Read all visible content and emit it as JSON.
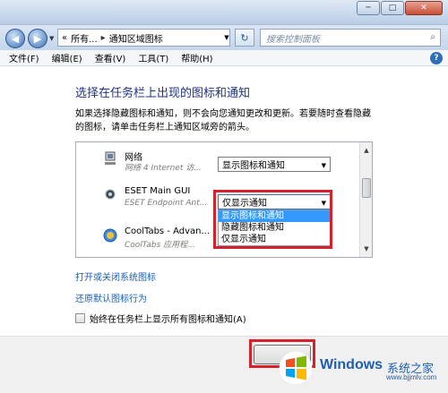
{
  "window": {
    "min_symbol": "─",
    "max_symbol": "□",
    "close_symbol": "✕"
  },
  "nav": {
    "back_symbol": "◀",
    "forward_symbol": "▶",
    "dropdown_symbol": "▼",
    "breadcrumb": [
      "«",
      "所有...",
      "▸",
      "通知区域图标"
    ],
    "refresh_symbol": "↻",
    "search_placeholder": "搜索控制面板",
    "search_icon": "⌕"
  },
  "menu": [
    "文件(F)",
    "编辑(E)",
    "查看(V)",
    "工具(T)",
    "帮助(H)"
  ],
  "help_icon": "?",
  "page": {
    "heading": "选择在任务栏上出现的图标和通知",
    "description": "如果选择隐藏图标和通知，则不会向您通知更改和更新。若要随时查看隐藏的图标，请单击任务栏上通知区域旁的箭头。"
  },
  "icons_list": [
    {
      "name": "网络",
      "subtitle": "网络 4 Internet 访...",
      "value": "显示图标和通知",
      "icon": "network-icon"
    },
    {
      "name": "ESET Main GUI",
      "subtitle": "ESET Endpoint Ant...",
      "value": "仅显示通知",
      "icon": "eset-icon"
    },
    {
      "name": "CoolTabs - Advan...",
      "subtitle": "CoolTabs 应用程...",
      "value": "",
      "icon": "cooltabs-icon"
    }
  ],
  "dropdown_options": [
    "显示图标和通知",
    "隐藏图标和通知",
    "仅显示通知"
  ],
  "dropdown_selected": "显示图标和通知",
  "links": {
    "system_icons": "打开或关闭系统图标",
    "restore_default": "还原默认图标行为"
  },
  "checkbox": {
    "label": "始终在任务栏上显示所有图标和通知(A)",
    "checked": false
  },
  "watermark": {
    "brand": "Windows",
    "cn": "系统之家",
    "url": "www.bjjmlv.com"
  },
  "colors": {
    "heading": "#1e3287",
    "link": "#1c5fb4",
    "highlight": "#3399ff",
    "annotation": "#d7202a"
  }
}
